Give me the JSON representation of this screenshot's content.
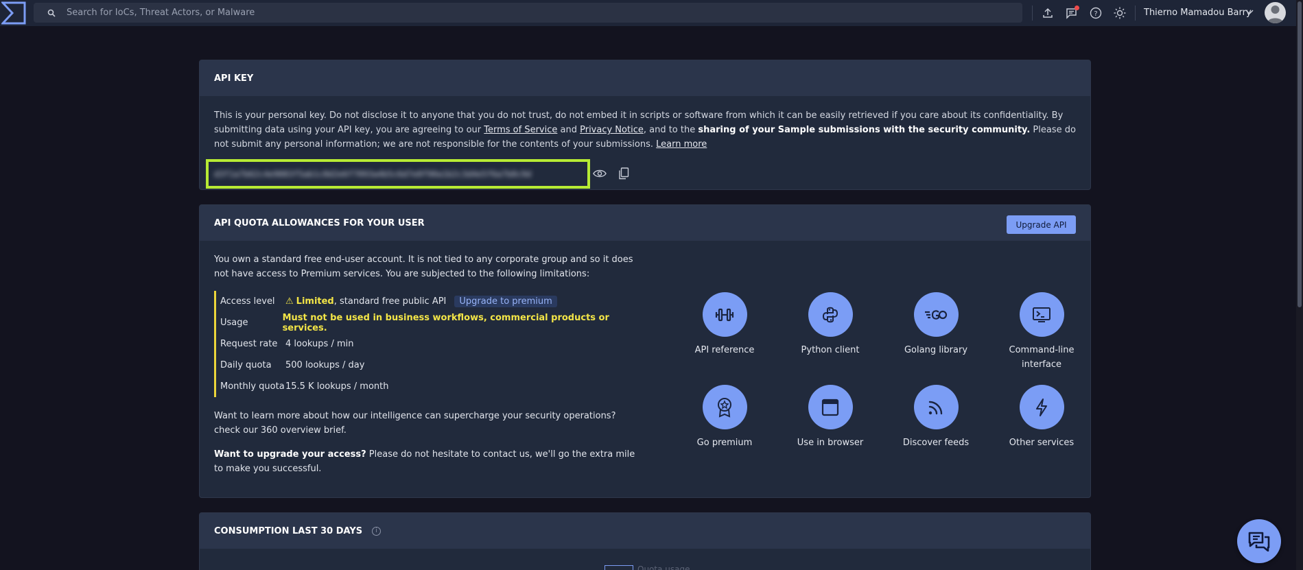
{
  "topbar": {
    "search_placeholder": "Search for IoCs, Threat Actors, or Malware",
    "user_name": "Thierno Mamadou Barry"
  },
  "api_key": {
    "title": "API KEY",
    "description_1": "This is your personal key. Do not disclose it to anyone that you do not trust, do not embed it in scripts or software from which it can be easily retrieved if you care about its confidentiality. By submitting data using your API key, you are agreeing to our ",
    "terms_link": "Terms of Service",
    "and": " and ",
    "privacy_link": "Privacy Notice",
    "description_2": ", and to the ",
    "description_bold": "sharing of your Sample submissions with the security community.",
    "description_3": " Please do not submit any personal information; we are not responsible for the contents of your submissions. ",
    "learn_more": "Learn more",
    "key_value": "d3f1a7b62c4e9083f5ab1c8d2e6f7093a4b5c6d7e8f90a1b2c3d4e5f6a7b8c9d"
  },
  "quota": {
    "title": "API QUOTA ALLOWANCES FOR YOUR USER",
    "upgrade_button": "Upgrade API",
    "intro": "You own a standard free end-user account. It is not tied to any corporate group and so it does not have access to Premium services. You are subjected to the following limitations:",
    "limits": {
      "access_label": "Access level",
      "access_warn_icon": "⚠",
      "access_bold": "Limited",
      "access_rest": ", standard free public API",
      "access_link": "Upgrade to premium",
      "usage_label": "Usage",
      "usage_value": "Must not be used in business workflows, commercial products or services.",
      "rate_label": "Request rate",
      "rate_value": "4 lookups / min",
      "daily_label": "Daily quota",
      "daily_value": "500 lookups / day",
      "monthly_label": "Monthly quota",
      "monthly_value": "15.5 K lookups / month"
    },
    "learn_para": "Want to learn more about how our intelligence can supercharge your security operations? check our 360 overview brief.",
    "upgrade_bold": "Want to upgrade your access?",
    "upgrade_rest": " Please do not hesitate to contact us, we'll go the extra mile to make you successful.",
    "tiles": [
      {
        "label": "API reference",
        "icon": "dumbbell-icon"
      },
      {
        "label": "Python client",
        "icon": "python-icon"
      },
      {
        "label": "Golang library",
        "icon": "golang-icon"
      },
      {
        "label": "Command-line interface",
        "icon": "terminal-icon"
      },
      {
        "label": "Go premium",
        "icon": "award-icon"
      },
      {
        "label": "Use in browser",
        "icon": "browser-icon"
      },
      {
        "label": "Discover feeds",
        "icon": "rss-icon"
      },
      {
        "label": "Other services",
        "icon": "lightning-icon"
      }
    ]
  },
  "consumption": {
    "title": "CONSUMPTION LAST 30 DAYS",
    "legend": "Quota usage"
  },
  "colors": {
    "background": "#13131f",
    "card": "#212a3c",
    "accent": "#7c9df5",
    "highlight_border": "#b7eb34",
    "warning": "#f3e547"
  }
}
